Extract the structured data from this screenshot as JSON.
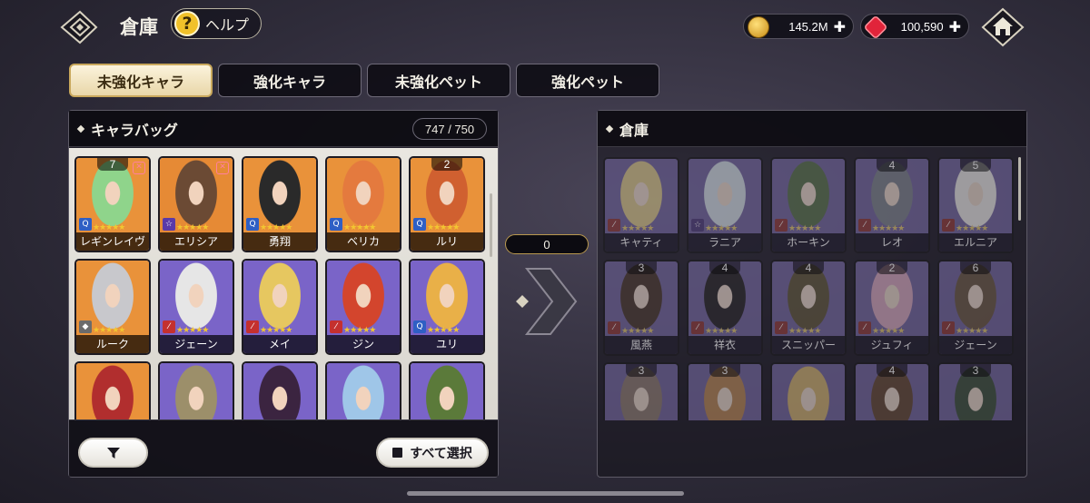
{
  "header": {
    "title": "倉庫",
    "help_label": "ヘルプ",
    "help_icon_glyph": "?",
    "gold_value": "145.2M",
    "gem_value": "100,590",
    "plus_glyph": "✚"
  },
  "tabs": [
    {
      "label": "未強化キャラ",
      "active": true
    },
    {
      "label": "強化キャラ",
      "active": false
    },
    {
      "label": "未強化ペット",
      "active": false
    },
    {
      "label": "強化ペット",
      "active": false
    }
  ],
  "left_panel": {
    "title": "キャラバッグ",
    "count": "747 / 750",
    "select_all_label": "すべて選択",
    "cards": [
      {
        "name": "レギンレイヴ",
        "num": "7",
        "fav": true,
        "cls": "q",
        "bg": "#e9923a",
        "skin": "#8fd48b"
      },
      {
        "name": "エリシア",
        "num": "",
        "fav": true,
        "cls": "star",
        "bg": "#e68a35",
        "skin": "#6b4a34"
      },
      {
        "name": "勇翔",
        "num": "",
        "fav": false,
        "cls": "q",
        "bg": "#e9923a",
        "skin": "#2a2a2a"
      },
      {
        "name": "ベリカ",
        "num": "",
        "fav": false,
        "cls": "q",
        "bg": "#e9923a",
        "skin": "#e47a3e"
      },
      {
        "name": "ルリ",
        "num": "2",
        "fav": false,
        "cls": "q",
        "bg": "#e9923a",
        "skin": "#d06030"
      },
      {
        "name": "ルーク",
        "num": "",
        "fav": false,
        "cls": "shield",
        "bg": "#e9923a",
        "skin": "#c8c8cc"
      },
      {
        "name": "ジェーン",
        "num": "",
        "fav": false,
        "cls": "sword",
        "bg": "#7a64c8",
        "skin": "#e6e6e6"
      },
      {
        "name": "メイ",
        "num": "",
        "fav": false,
        "cls": "sword",
        "bg": "#7a64c8",
        "skin": "#e6c760"
      },
      {
        "name": "ジン",
        "num": "",
        "fav": false,
        "cls": "sword",
        "bg": "#7a64c8",
        "skin": "#d3452d"
      },
      {
        "name": "ユリ",
        "num": "",
        "fav": false,
        "cls": "q",
        "bg": "#7a64c8",
        "skin": "#e9b048"
      },
      {
        "name": "",
        "num": "",
        "fav": false,
        "cls": "q",
        "bg": "#e9923a",
        "skin": "#b12e2e"
      },
      {
        "name": "",
        "num": "",
        "fav": false,
        "cls": "",
        "bg": "#7a64c8",
        "skin": "#9c8f6a"
      },
      {
        "name": "",
        "num": "",
        "fav": false,
        "cls": "",
        "bg": "#7a64c8",
        "skin": "#3b2440"
      },
      {
        "name": "",
        "num": "",
        "fav": false,
        "cls": "",
        "bg": "#7a64c8",
        "skin": "#9fc6e8"
      },
      {
        "name": "",
        "num": "",
        "fav": false,
        "cls": "",
        "bg": "#7a64c8",
        "skin": "#5b7a3a"
      }
    ]
  },
  "transfer": {
    "count": "0"
  },
  "right_panel": {
    "title": "倉庫",
    "cards": [
      {
        "name": "キャティ",
        "num": "",
        "cls": "sword",
        "bg": "#7a64c8",
        "skin": "#e6c760"
      },
      {
        "name": "ラニア",
        "num": "",
        "cls": "star",
        "bg": "#7a64c8",
        "skin": "#c9dbea"
      },
      {
        "name": "ホーキン",
        "num": "",
        "cls": "sword",
        "bg": "#7a64c8",
        "skin": "#4f7a3a"
      },
      {
        "name": "レオ",
        "num": "4",
        "cls": "sword",
        "bg": "#7a64c8",
        "skin": "#7b8598"
      },
      {
        "name": "エルニア",
        "num": "5",
        "cls": "sword",
        "bg": "#7a64c8",
        "skin": "#e8e6e2"
      },
      {
        "name": "風燕",
        "num": "3",
        "cls": "sword",
        "bg": "#7a64c8",
        "skin": "#5a3a2a"
      },
      {
        "name": "祥衣",
        "num": "4",
        "cls": "sword",
        "bg": "#7a64c8",
        "skin": "#2f2a30"
      },
      {
        "name": "スニッパー",
        "num": "4",
        "cls": "sword",
        "bg": "#7a64c8",
        "skin": "#6b5a2a"
      },
      {
        "name": "ジュフィ",
        "num": "2",
        "cls": "sword",
        "bg": "#7a64c8",
        "skin": "#f0a0c8"
      },
      {
        "name": "ジェーン",
        "num": "6",
        "cls": "sword",
        "bg": "#7a64c8",
        "skin": "#7a5a3a"
      },
      {
        "name": "",
        "num": "3",
        "cls": "",
        "bg": "#7a64c8",
        "skin": "#9a7a6a"
      },
      {
        "name": "",
        "num": "3",
        "cls": "",
        "bg": "#7a64c8",
        "skin": "#d8822e"
      },
      {
        "name": "",
        "num": "",
        "cls": "",
        "bg": "#7a64c8",
        "skin": "#e6b040"
      },
      {
        "name": "",
        "num": "4",
        "cls": "",
        "bg": "#7a64c8",
        "skin": "#7a4a2a"
      },
      {
        "name": "",
        "num": "3",
        "cls": "",
        "bg": "#7a64c8",
        "skin": "#3a5a3a"
      }
    ]
  },
  "glyphs": {
    "stars": "★★★★★",
    "fav": "✕",
    "q": "Q",
    "star": "☆",
    "sword": "⁄",
    "shield": "◆"
  },
  "colors": {
    "gold_accent": "#c9a85c",
    "active_tab_bg": "#f5ead0",
    "gem_red": "#e1243a",
    "coin_gold": "#e8b233"
  }
}
